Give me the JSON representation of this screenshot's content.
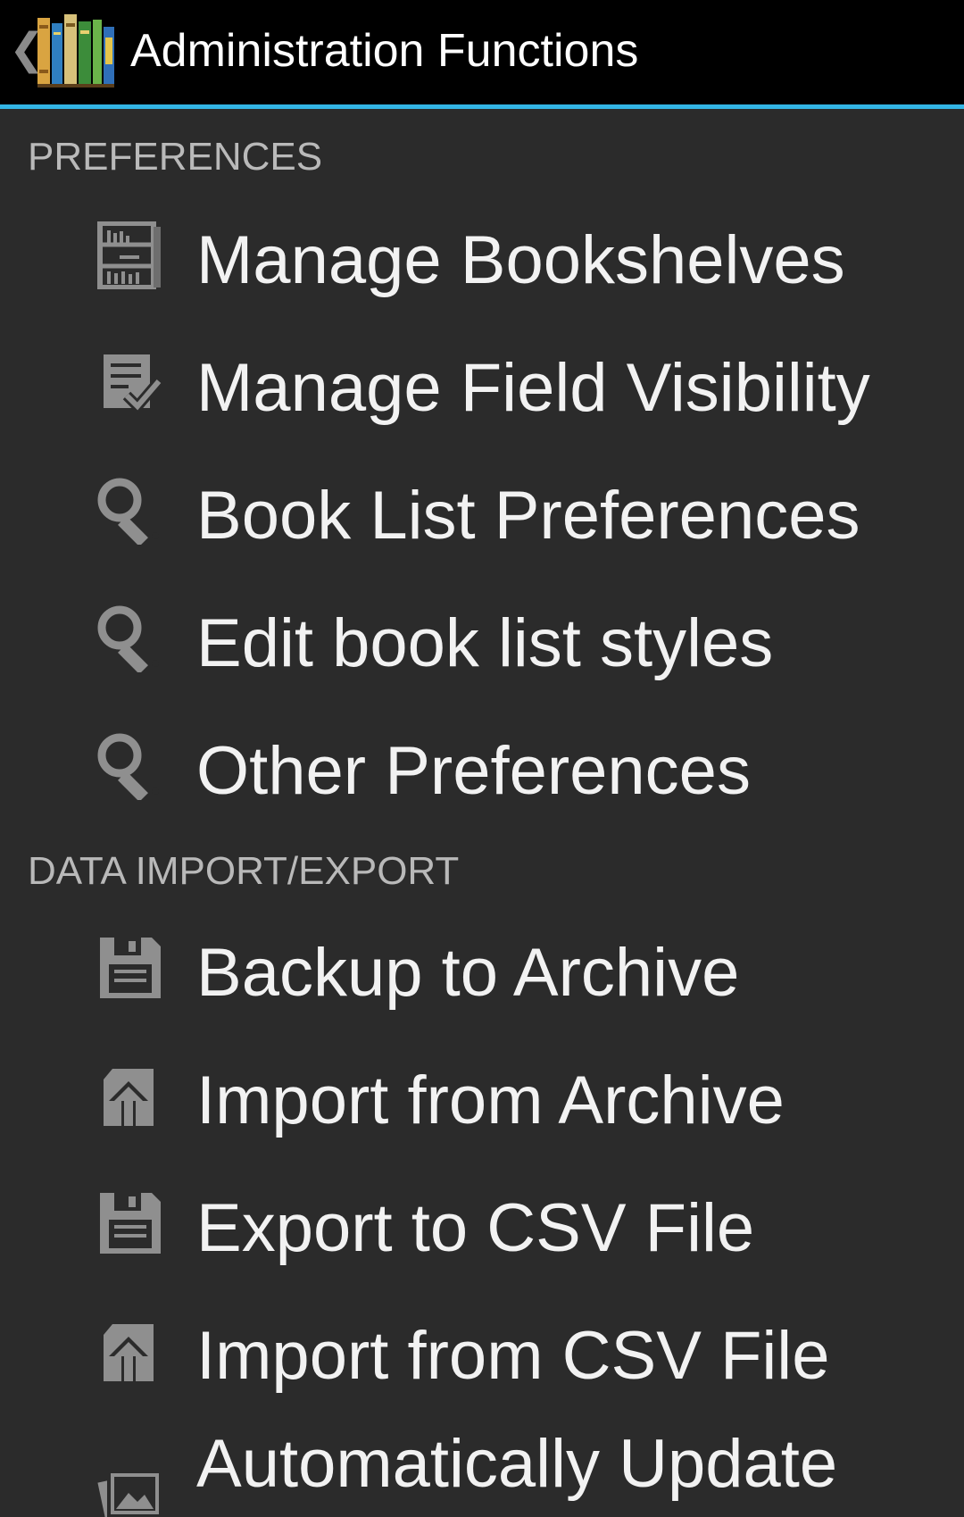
{
  "actionbar": {
    "title": "Administration Functions",
    "back_glyph": "❮",
    "app_icon": "bookshelf-app-icon",
    "accent_color": "#33b5e5"
  },
  "sections": [
    {
      "header": "PREFERENCES",
      "items": [
        {
          "label": "Manage Bookshelves",
          "icon": "bookshelf-icon"
        },
        {
          "label": "Manage Field Visibility",
          "icon": "checklist-icon"
        },
        {
          "label": "Book List Preferences",
          "icon": "wrench-icon"
        },
        {
          "label": "Edit book list styles",
          "icon": "wrench-icon"
        },
        {
          "label": "Other Preferences",
          "icon": "wrench-icon"
        }
      ]
    },
    {
      "header": "DATA IMPORT/EXPORT",
      "items": [
        {
          "label": "Backup to Archive",
          "icon": "floppy-icon"
        },
        {
          "label": "Import from Archive",
          "icon": "import-icon"
        },
        {
          "label": "Export to CSV File",
          "icon": "floppy-icon"
        },
        {
          "label": "Import from CSV File",
          "icon": "import-icon"
        },
        {
          "label": "Automatically Update",
          "icon": "photos-icon"
        }
      ]
    }
  ]
}
